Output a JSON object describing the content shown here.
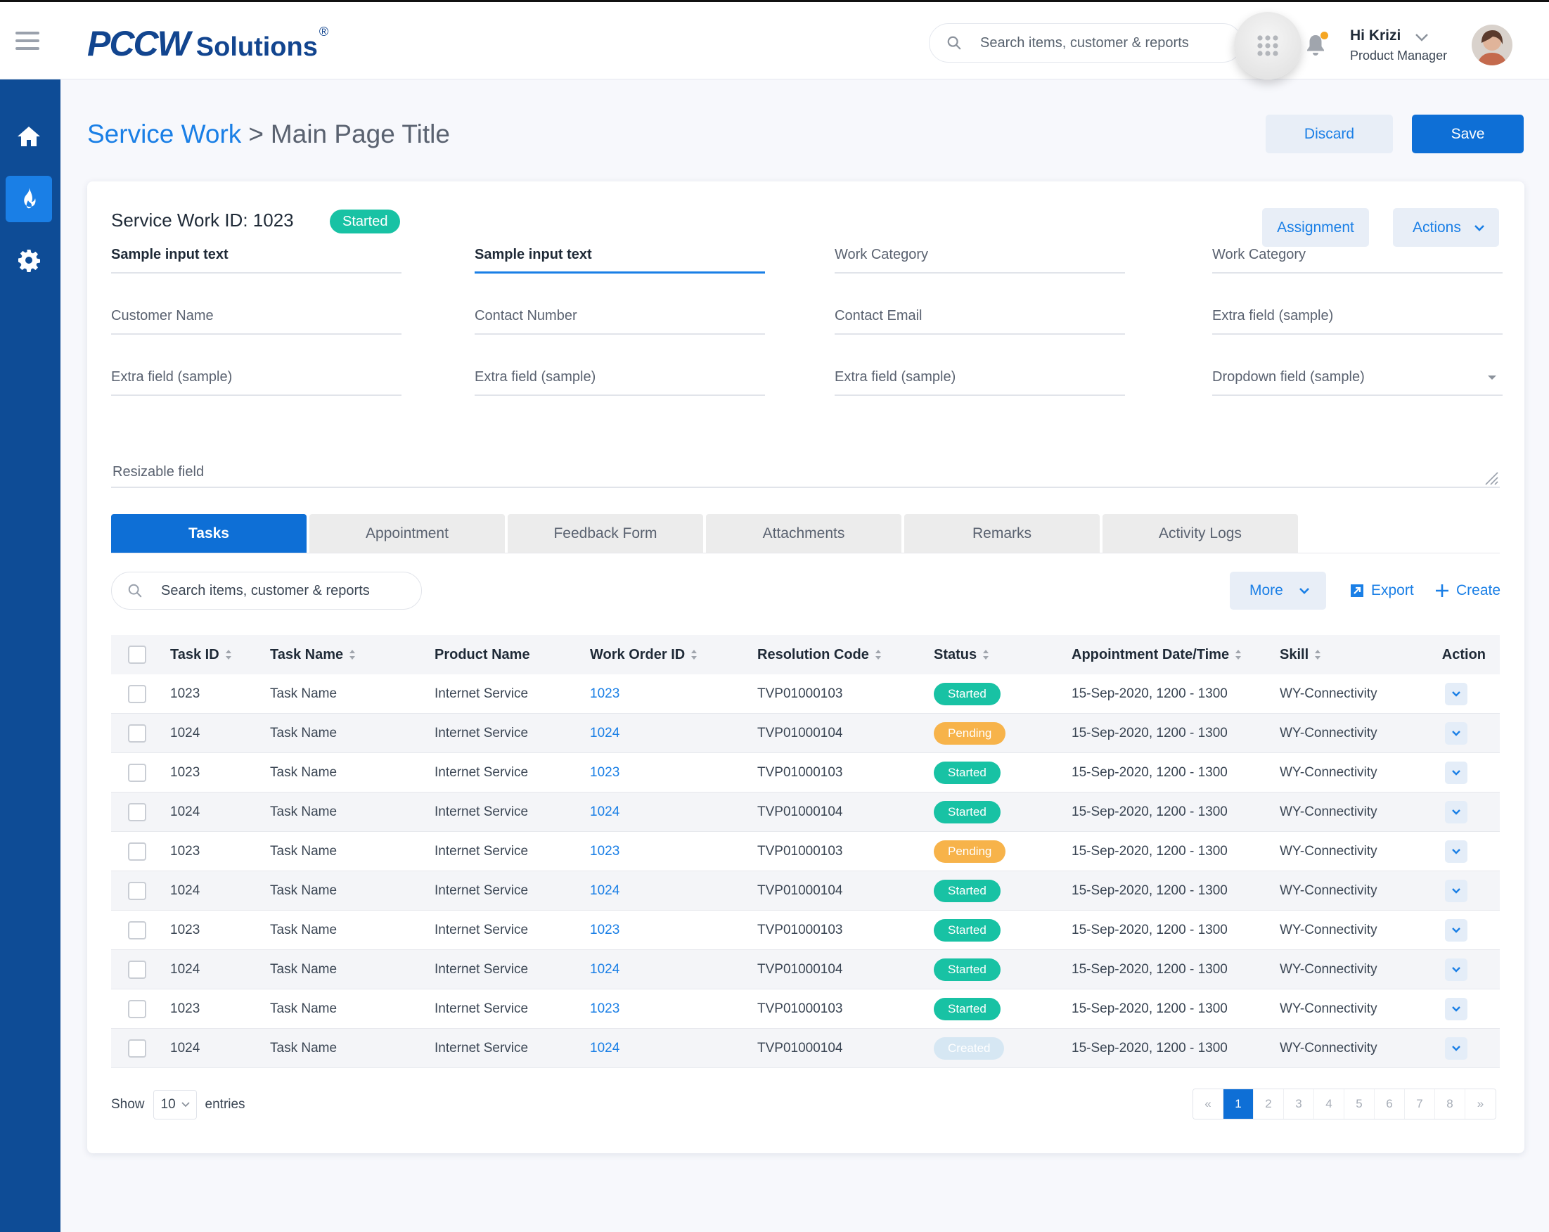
{
  "brand": {
    "name": "PCCW",
    "suffix": "Solutions",
    "mark": "®"
  },
  "header": {
    "search_placeholder": "Search items, customer & reports",
    "user_greeting": "Hi Krizi",
    "user_role": "Product Manager"
  },
  "sidebar": {
    "items": [
      "home-icon",
      "flame-icon",
      "gear-icon"
    ],
    "active": 1
  },
  "breadcrumb": {
    "parent": "Service Work",
    "separator": ">",
    "current": "Main Page Title"
  },
  "page_actions": {
    "discard": "Discard",
    "save": "Save"
  },
  "record": {
    "title": "Service Work ID: 1023",
    "status": "Started",
    "assignment": "Assignment",
    "actions": "Actions"
  },
  "form": {
    "row1": [
      "Sample input text",
      "Sample input text",
      "Work Category",
      "Work Category"
    ],
    "row2": [
      "Customer Name",
      "Contact Number",
      "Contact Email",
      "Extra field (sample)"
    ],
    "row3": [
      "Extra field (sample)",
      "Extra field (sample)",
      "Extra field (sample)",
      "Dropdown field (sample)"
    ],
    "resizable": "Resizable field"
  },
  "tabs": [
    "Tasks",
    "Appointment",
    "Feedback Form",
    "Attachments",
    "Remarks",
    "Activity Logs"
  ],
  "toolbar": {
    "search_placeholder": "Search items, customer & reports",
    "more": "More",
    "export": "Export",
    "create": "Create"
  },
  "table": {
    "headers": [
      "Task ID",
      "Task Name",
      "Product Name",
      "Work Order ID",
      "Resolution Code",
      "Status",
      "Appointment Date/Time",
      "Skill",
      "Action"
    ],
    "rows": [
      [
        "1023",
        "Task Name",
        "Internet Service",
        "1023",
        "TVP01000103",
        "Started",
        "15-Sep-2020, 1200 - 1300",
        "WY-Connectivity"
      ],
      [
        "1024",
        "Task Name",
        "Internet Service",
        "1024",
        "TVP01000104",
        "Pending",
        "15-Sep-2020, 1200 - 1300",
        "WY-Connectivity"
      ],
      [
        "1023",
        "Task Name",
        "Internet Service",
        "1023",
        "TVP01000103",
        "Started",
        "15-Sep-2020, 1200 - 1300",
        "WY-Connectivity"
      ],
      [
        "1024",
        "Task Name",
        "Internet Service",
        "1024",
        "TVP01000104",
        "Started",
        "15-Sep-2020, 1200 - 1300",
        "WY-Connectivity"
      ],
      [
        "1023",
        "Task Name",
        "Internet Service",
        "1023",
        "TVP01000103",
        "Pending",
        "15-Sep-2020, 1200 - 1300",
        "WY-Connectivity"
      ],
      [
        "1024",
        "Task Name",
        "Internet Service",
        "1024",
        "TVP01000104",
        "Started",
        "15-Sep-2020, 1200 - 1300",
        "WY-Connectivity"
      ],
      [
        "1023",
        "Task Name",
        "Internet Service",
        "1023",
        "TVP01000103",
        "Started",
        "15-Sep-2020, 1200 - 1300",
        "WY-Connectivity"
      ],
      [
        "1024",
        "Task Name",
        "Internet Service",
        "1024",
        "TVP01000104",
        "Started",
        "15-Sep-2020, 1200 - 1300",
        "WY-Connectivity"
      ],
      [
        "1023",
        "Task Name",
        "Internet Service",
        "1023",
        "TVP01000103",
        "Started",
        "15-Sep-2020, 1200 - 1300",
        "WY-Connectivity"
      ],
      [
        "1024",
        "Task Name",
        "Internet Service",
        "1024",
        "TVP01000104",
        "Created",
        "15-Sep-2020, 1200 - 1300",
        "WY-Connectivity"
      ]
    ]
  },
  "footer": {
    "show_label": "Show",
    "page_size": "10",
    "entries_label": "entries",
    "pages": [
      "«",
      "1",
      "2",
      "3",
      "4",
      "5",
      "6",
      "7",
      "8",
      "»"
    ],
    "current_page": "1"
  },
  "colors": {
    "primary": "#0e6fd6",
    "sidebar": "#0e4c96",
    "started": "#18c2a4",
    "pending": "#f7b34a",
    "created": "#d6e7f3"
  }
}
